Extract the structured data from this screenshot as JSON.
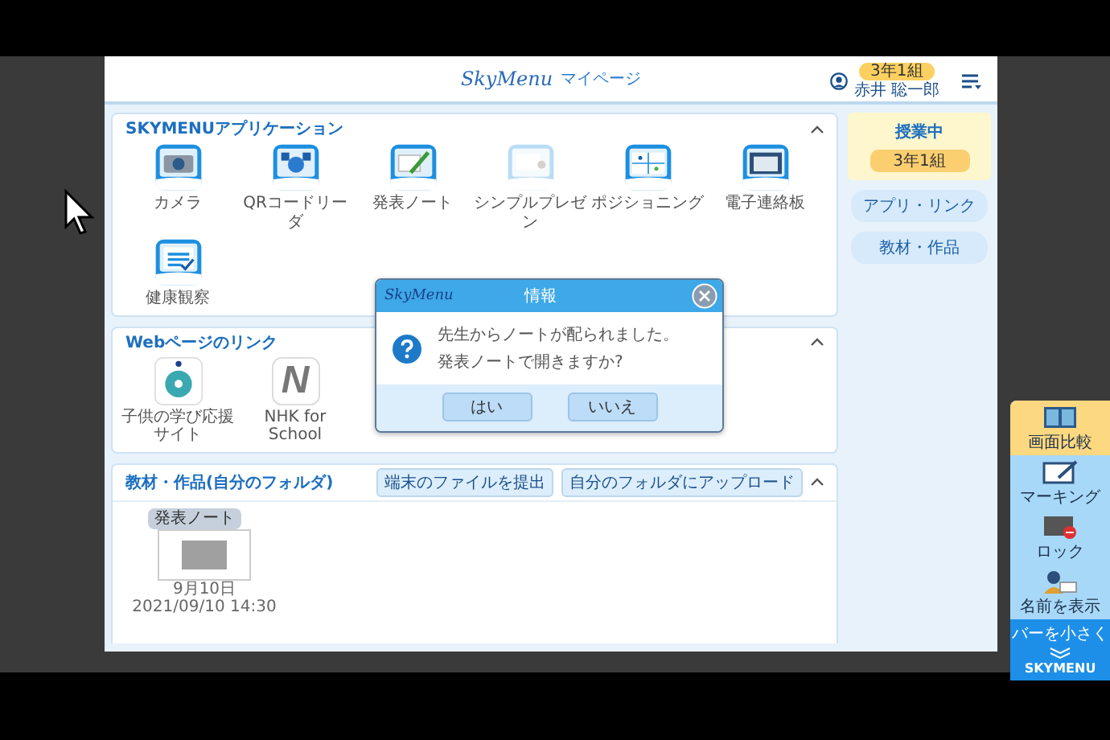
{
  "header": {
    "logo": "SkyMenu",
    "title": "マイページ",
    "class_badge": "3年1組",
    "user_name": "赤井 聡一郎"
  },
  "apps_section": {
    "title": "SKYMENUアプリケーション",
    "apps": [
      {
        "label": "カメラ",
        "kind": "camera",
        "disabled": false
      },
      {
        "label": "QRコードリーダ",
        "kind": "qr",
        "disabled": false
      },
      {
        "label": "発表ノート",
        "kind": "note",
        "disabled": false
      },
      {
        "label": "シンプルプレゼン",
        "kind": "presen",
        "disabled": true
      },
      {
        "label": "ポジショニング",
        "kind": "position",
        "disabled": false
      },
      {
        "label": "電子連絡板",
        "kind": "board",
        "disabled": false
      },
      {
        "label": "健康観察",
        "kind": "calendar",
        "disabled": false
      }
    ]
  },
  "links_section": {
    "title": "Webページのリンク",
    "links": [
      {
        "label": "子供の学び応援サイト",
        "kind": "circle"
      },
      {
        "label": "NHK for School",
        "kind": "letter",
        "letter": "N"
      }
    ]
  },
  "materials_section": {
    "title": "教材・作品",
    "subtitle": "(自分のフォルダ)",
    "buttons": [
      "端末のファイルを提出",
      "自分のフォルダにアップロード"
    ],
    "items": [
      {
        "tag": "発表ノート",
        "date": "9月10日",
        "timestamp": "2021/09/10 14:30"
      }
    ]
  },
  "sidebar": {
    "status": "授業中",
    "class_badge": "3年1組",
    "links": [
      "アプリ・リンク",
      "教材・作品"
    ]
  },
  "dialog": {
    "logo": "SkyMenu",
    "title": "情報",
    "message_lines": [
      "先生からノートが配られました。",
      "発表ノートで開きますか?"
    ],
    "buttons": [
      "はい",
      "いいえ"
    ]
  },
  "toolbar": {
    "items": [
      {
        "label": "画面比較",
        "kind": "compare",
        "selected": true
      },
      {
        "label": "マーキング",
        "kind": "marking",
        "selected": false
      },
      {
        "label": "ロック",
        "kind": "lock",
        "selected": false
      },
      {
        "label": "名前を表示",
        "kind": "name",
        "selected": false
      }
    ],
    "collapse": "バーを小さく",
    "brand": "SKYMENU"
  }
}
